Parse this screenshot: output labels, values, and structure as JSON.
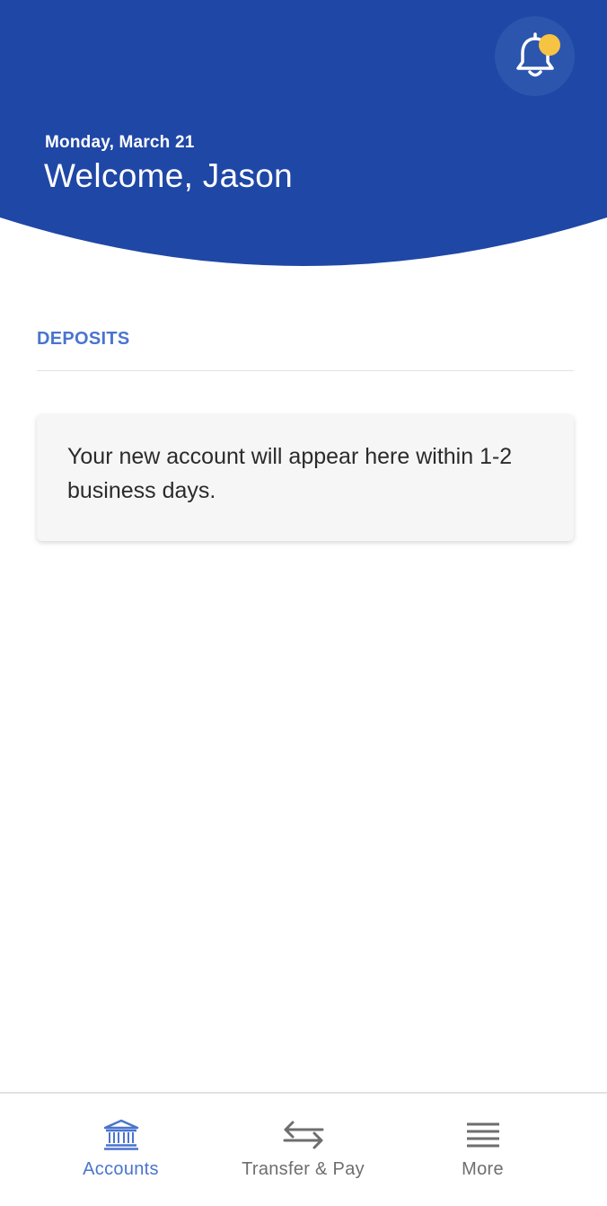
{
  "header": {
    "date": "Monday, March 21",
    "welcome": "Welcome, Jason",
    "notification_icon": "bell-icon",
    "has_unread_notification": true
  },
  "deposits": {
    "title": "DEPOSITS",
    "empty_message": "Your new account will appear here within 1-2 business days."
  },
  "tabbar": {
    "items": [
      {
        "label": "Accounts",
        "icon": "bank-icon",
        "active": true
      },
      {
        "label": "Transfer & Pay",
        "icon": "transfer-arrows-icon",
        "active": false
      },
      {
        "label": "More",
        "icon": "menu-icon",
        "active": false
      }
    ]
  },
  "colors": {
    "brand_blue": "#1f47a6",
    "accent_blue": "#4a74cf",
    "notification_dot": "#f6c343",
    "inactive_gray": "#6e6e6e"
  }
}
